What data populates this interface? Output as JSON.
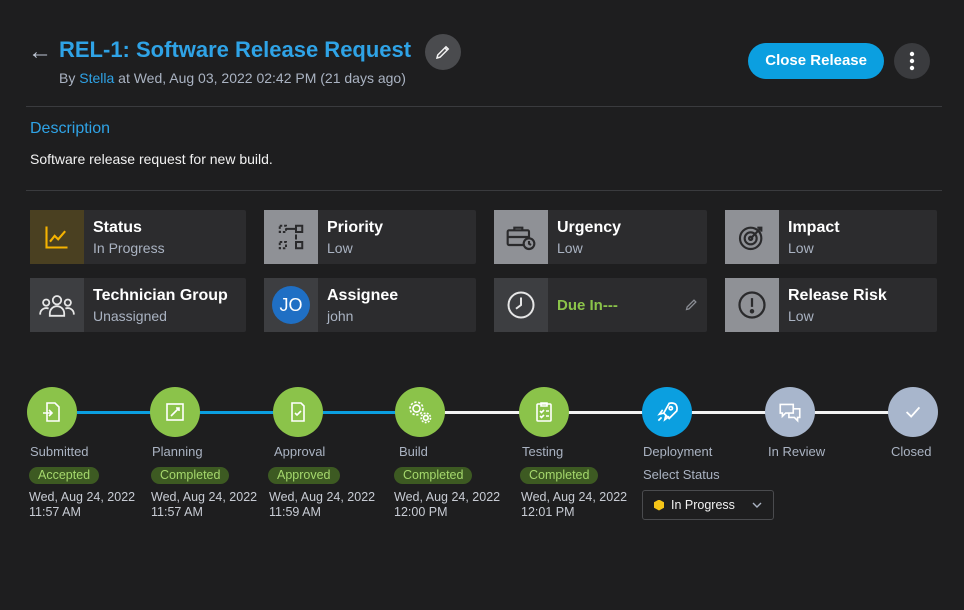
{
  "header": {
    "back_icon": "arrow-left-icon",
    "title": "REL-1: Software Release Request",
    "by_prefix": "By",
    "author": "Stella",
    "created_text": "at Wed, Aug 03, 2022 02:42 PM (21 days ago)",
    "close_button": "Close Release"
  },
  "description": {
    "label": "Description",
    "text": "Software release request for new build."
  },
  "cards": {
    "status": {
      "label": "Status",
      "value": "In Progress",
      "icon": "trend-chart-icon"
    },
    "priority": {
      "label": "Priority",
      "value": "Low",
      "icon": "priority-flow-icon"
    },
    "urgency": {
      "label": "Urgency",
      "value": "Low",
      "icon": "briefcase-clock-icon"
    },
    "impact": {
      "label": "Impact",
      "value": "Low",
      "icon": "target-icon"
    },
    "technician_group": {
      "label": "Technician Group",
      "value": "Unassigned",
      "icon": "group-icon"
    },
    "assignee": {
      "label": "Assignee",
      "value": "john",
      "initials": "JO"
    },
    "due": {
      "label": "Due In---",
      "icon": "clock-icon"
    },
    "release_risk": {
      "label": "Release Risk",
      "value": "Low",
      "icon": "exclamation-icon"
    }
  },
  "stages": [
    {
      "name": "Submitted",
      "badge": "Accepted",
      "date": "Wed, Aug 24, 2022",
      "time": "11:57 AM"
    },
    {
      "name": "Planning",
      "badge": "Completed",
      "date": "Wed, Aug 24, 2022",
      "time": "11:57 AM"
    },
    {
      "name": "Approval",
      "badge": "Approved",
      "date": "Wed, Aug 24, 2022",
      "time": "11:59 AM"
    },
    {
      "name": "Build",
      "badge": "Completed",
      "date": "Wed, Aug 24, 2022",
      "time": "12:00 PM"
    },
    {
      "name": "Testing",
      "badge": "Completed",
      "date": "Wed, Aug 24, 2022",
      "time": "12:01 PM"
    },
    {
      "name": "Deployment",
      "select_label": "Select Status",
      "selected": "In Progress"
    },
    {
      "name": "In Review"
    },
    {
      "name": "Closed"
    }
  ],
  "colors": {
    "accent": "#0b9fe0",
    "done": "#8bc34a",
    "pending": "#a8b6cc",
    "background": "#1e1e1f"
  }
}
